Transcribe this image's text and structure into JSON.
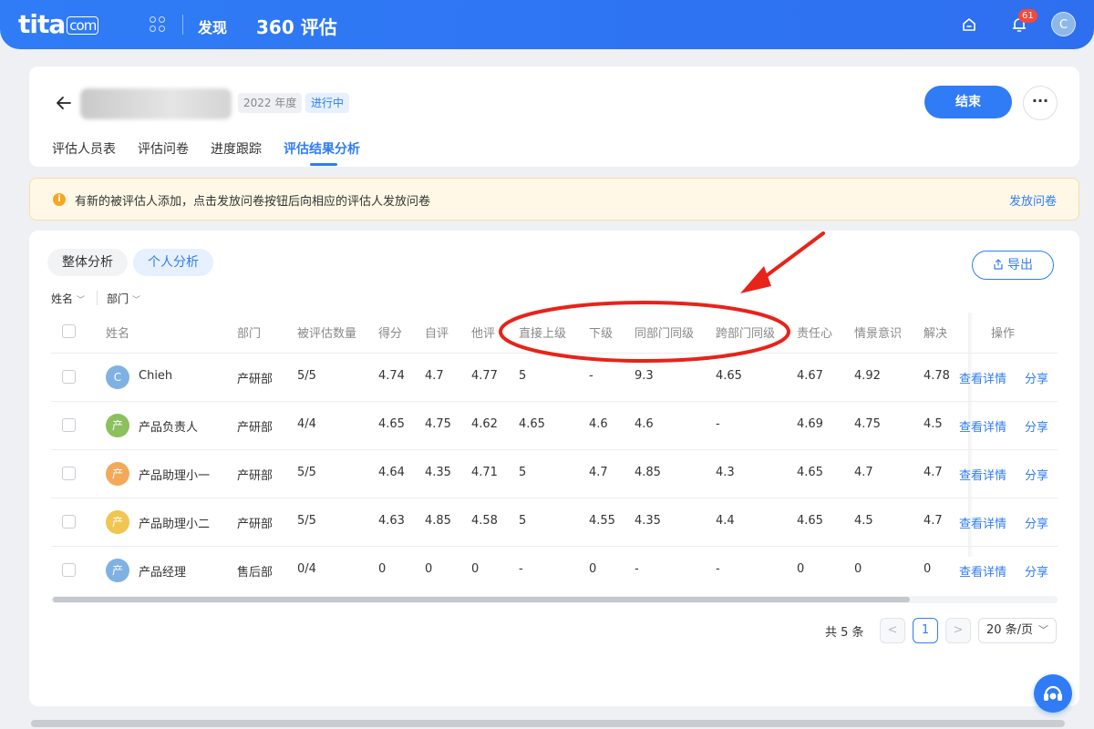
{
  "topbar": {
    "logo": "tita",
    "logo_com": "com",
    "nav_discover": "发现",
    "nav_title": "360 评估",
    "notification_count": "61",
    "avatar_initial": "C"
  },
  "header": {
    "year_tag": "2022 年度",
    "status_tag": "进行中",
    "end_button": "结束",
    "more_button": "···",
    "tabs": [
      "评估人员表",
      "评估问卷",
      "进度跟踪",
      "评估结果分析"
    ]
  },
  "notice": {
    "text": "有新的被评估人添加，点击发放问卷按钮后向相应的评估人发放问卷",
    "link": "发放问卷"
  },
  "analysis": {
    "segments": [
      "整体分析",
      "个人分析"
    ],
    "export_button": "导出",
    "filters": [
      "姓名",
      "部门"
    ]
  },
  "table": {
    "headers": [
      "姓名",
      "部门",
      "被评估数量",
      "得分",
      "自评",
      "他评",
      "直接上级",
      "下级",
      "同部门同级",
      "跨部门同级",
      "责任心",
      "情景意识",
      "解决",
      "操作"
    ],
    "rows": [
      {
        "avatar": "C",
        "avatar_color": "#7fb2e3",
        "name": "Chieh",
        "dept": "产研部",
        "count": "5/5",
        "score": "4.74",
        "self": "4.7",
        "others": "4.77",
        "manager": "5",
        "sub": "-",
        "peer_same": "9.3",
        "peer_cross": "4.65",
        "resp": "4.67",
        "situ": "4.92",
        "solve": "4.78",
        "view": "查看详情",
        "share": "分享"
      },
      {
        "avatar": "产",
        "avatar_color": "#8cbf5e",
        "name": "产品负责人",
        "dept": "产研部",
        "count": "4/4",
        "score": "4.65",
        "self": "4.75",
        "others": "4.62",
        "manager": "4.65",
        "sub": "4.6",
        "peer_same": "4.6",
        "peer_cross": "-",
        "resp": "4.69",
        "situ": "4.75",
        "solve": "4.5",
        "view": "查看详情",
        "share": "分享"
      },
      {
        "avatar": "产",
        "avatar_color": "#f3a95a",
        "name": "产品助理小一",
        "dept": "产研部",
        "count": "5/5",
        "score": "4.64",
        "self": "4.35",
        "others": "4.71",
        "manager": "5",
        "sub": "4.7",
        "peer_same": "4.85",
        "peer_cross": "4.3",
        "resp": "4.65",
        "situ": "4.7",
        "solve": "4.7",
        "view": "查看详情",
        "share": "分享"
      },
      {
        "avatar": "产",
        "avatar_color": "#f0c552",
        "name": "产品助理小二",
        "dept": "产研部",
        "count": "5/5",
        "score": "4.63",
        "self": "4.85",
        "others": "4.58",
        "manager": "5",
        "sub": "4.55",
        "peer_same": "4.35",
        "peer_cross": "4.4",
        "resp": "4.65",
        "situ": "4.5",
        "solve": "4.7",
        "view": "查看详情",
        "share": "分享"
      },
      {
        "avatar": "产",
        "avatar_color": "#7fb2e3",
        "name": "产品经理",
        "dept": "售后部",
        "count": "0/4",
        "score": "0",
        "self": "0",
        "others": "0",
        "manager": "-",
        "sub": "0",
        "peer_same": "-",
        "peer_cross": "-",
        "resp": "0",
        "situ": "0",
        "solve": "0",
        "view": "查看详情",
        "share": "分享"
      }
    ]
  },
  "pagination": {
    "total": "共 5 条",
    "prev": "<",
    "current": "1",
    "next": ">",
    "page_size": "20 条/页"
  },
  "colors": {
    "primary": "#2f7cf6",
    "notice_bg": "#fff8e6",
    "annotation_red": "#e8231a"
  }
}
